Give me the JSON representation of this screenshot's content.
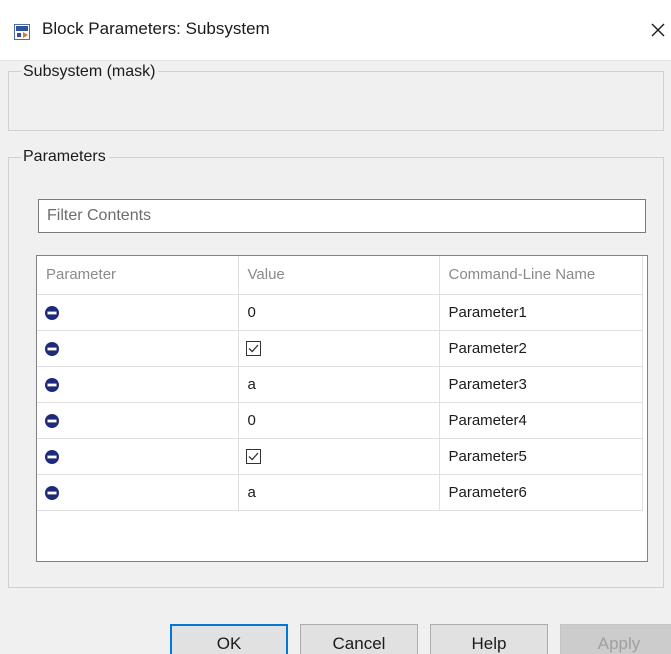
{
  "window": {
    "title": "Block Parameters: Subsystem"
  },
  "mask_group": {
    "label": "Subsystem (mask)"
  },
  "parameters_group": {
    "label": "Parameters",
    "filter_placeholder": "Filter Contents",
    "table": {
      "columns": [
        "Parameter",
        "Value",
        "Command-Line Name"
      ],
      "rows": [
        {
          "icon": "remove-circle-icon",
          "value": "0",
          "value_type": "text",
          "command_line_name": "Parameter1"
        },
        {
          "icon": "remove-circle-icon",
          "value": "",
          "value_type": "checkbox",
          "checked": true,
          "command_line_name": "Parameter2"
        },
        {
          "icon": "remove-circle-icon",
          "value": "a",
          "value_type": "text",
          "command_line_name": "Parameter3"
        },
        {
          "icon": "remove-circle-icon",
          "value": "0",
          "value_type": "text",
          "command_line_name": "Parameter4"
        },
        {
          "icon": "remove-circle-icon",
          "value": "",
          "value_type": "checkbox",
          "checked": true,
          "command_line_name": "Parameter5"
        },
        {
          "icon": "remove-circle-icon",
          "value": "a",
          "value_type": "text",
          "command_line_name": "Parameter6"
        }
      ]
    }
  },
  "buttons": {
    "ok": "OK",
    "cancel": "Cancel",
    "help": "Help",
    "apply": "Apply"
  },
  "colors": {
    "icon_navy": "#1f2a7a",
    "default_button_border": "#0078d7"
  }
}
